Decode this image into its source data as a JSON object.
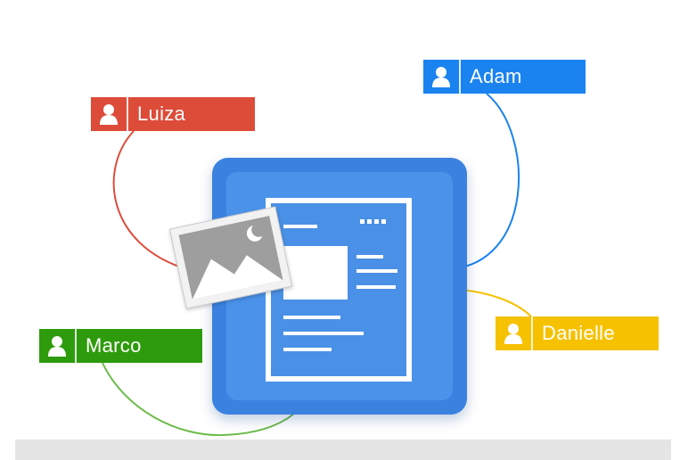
{
  "collaborators": [
    {
      "name": "Luiza",
      "color": "#dd4b39"
    },
    {
      "name": "Adam",
      "color": "#1a83f0"
    },
    {
      "name": "Marco",
      "color": "#2e9b0d"
    },
    {
      "name": "Danielle",
      "color": "#f6c100"
    }
  ],
  "icons": {
    "person": "person-icon",
    "document": "document-icon",
    "image": "image-icon"
  },
  "colors": {
    "tile": "#3b82e0",
    "footer": "#e5e5e5"
  }
}
